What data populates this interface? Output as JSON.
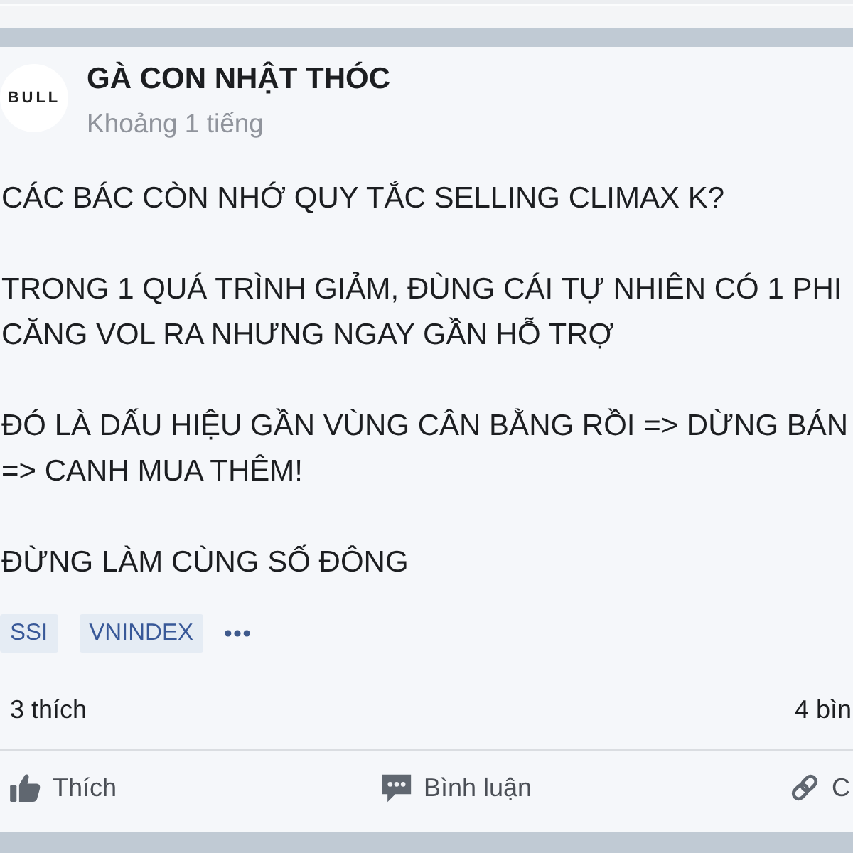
{
  "post": {
    "avatar": {
      "logo_text": "BULL"
    },
    "author": "GÀ CON NHẬT THÓC",
    "time": "Khoảng 1 tiếng",
    "paragraphs": [
      {
        "lines": [
          "CÁC BÁC CÒN NHỚ QUY TẮC SELLING CLIMAX K?"
        ]
      },
      {
        "lines": [
          "TRONG 1 QUÁ TRÌNH GIẢM, ĐÙNG CÁI TỰ NHIÊN CÓ 1 PHI",
          "CĂNG VOL RA NHƯNG NGAY GẦN HỖ TRỢ"
        ]
      },
      {
        "lines": [
          "ĐÓ LÀ DẤU HIỆU GẦN VÙNG CÂN BẰNG RỒI => DỪNG BÁN",
          "=> CANH MUA THÊM!"
        ]
      },
      {
        "lines": [
          "ĐỪNG LÀM CÙNG SỐ ĐÔNG"
        ]
      }
    ],
    "tags": [
      {
        "label": "SSI"
      },
      {
        "label": "VNINDEX"
      }
    ],
    "stats": {
      "likes": "3 thích",
      "comments": "4 bìn"
    },
    "actions": [
      {
        "kind": "like",
        "label": "Thích"
      },
      {
        "kind": "comment",
        "label": "Bình luận"
      },
      {
        "kind": "share",
        "label": "C"
      }
    ]
  }
}
